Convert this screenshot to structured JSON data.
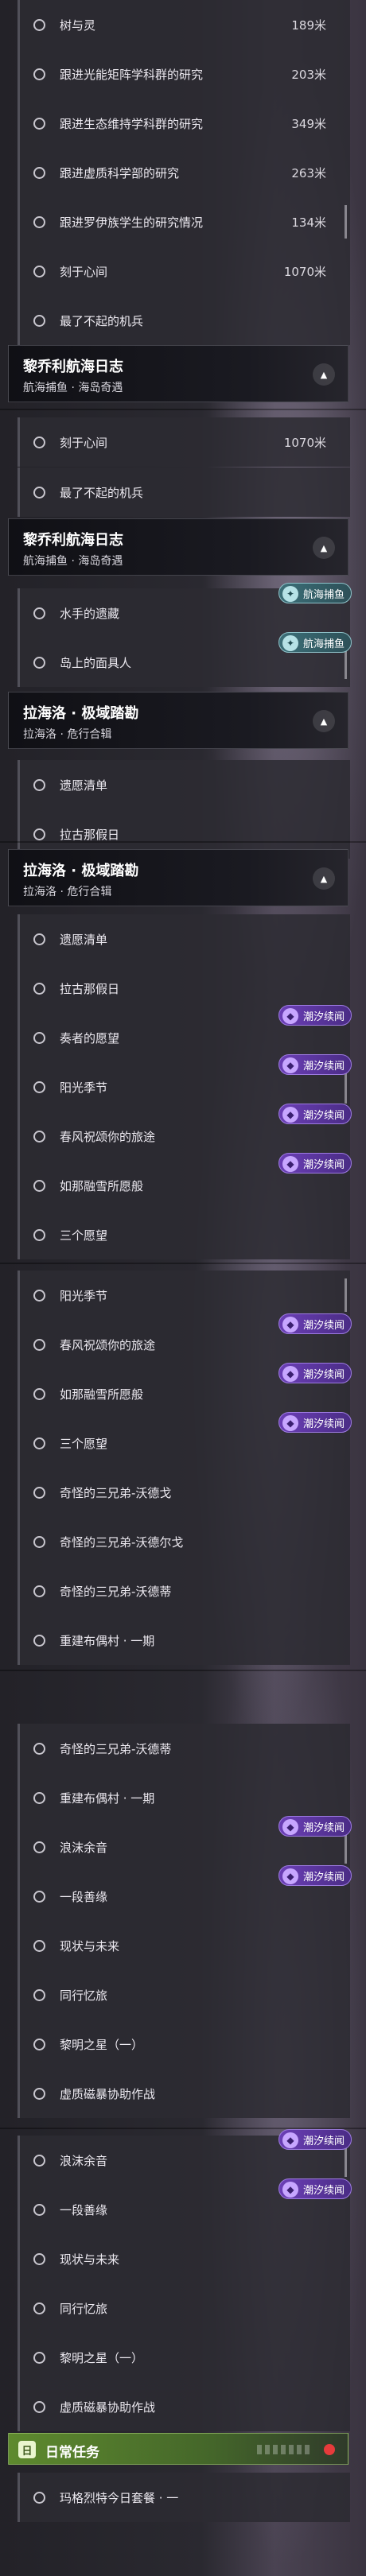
{
  "screens": [
    {
      "rows": [
        {
          "label": "树与灵",
          "dist": "189米"
        },
        {
          "label": "跟进光能矩阵学科群的研究",
          "dist": "203米"
        },
        {
          "label": "跟进生态维持学科群的研究",
          "dist": "349米"
        },
        {
          "label": "跟进虚质科学部的研究",
          "dist": "263米"
        },
        {
          "label": "跟进罗伊族学生的研究情况",
          "dist": "134米"
        },
        {
          "label": "刻于心间",
          "dist": "1070米"
        },
        {
          "label": "最了不起的机兵",
          "dist": ""
        }
      ],
      "header": {
        "title": "黎乔利航海日志",
        "sub": "航海捕鱼 · 海岛奇遇"
      }
    },
    {
      "rows": [
        {
          "label": "刻于心间",
          "dist": "1070米"
        },
        {
          "label": "最了不起的机兵",
          "dist": ""
        }
      ],
      "header": {
        "title": "黎乔利航海日志",
        "sub": "航海捕鱼 · 海岛奇遇"
      },
      "rows2": [
        {
          "label": "水手的遗藏",
          "tag": "航海捕鱼"
        },
        {
          "label": "岛上的面具人",
          "tag": "航海捕鱼"
        }
      ],
      "header2": {
        "title": "拉海洛 · 极域踏勘",
        "sub": "拉海洛 · 危行合辑"
      },
      "rows3": [
        {
          "label": "遗愿清单"
        },
        {
          "label": "拉古那假日"
        }
      ]
    },
    {
      "header": {
        "title": "拉海洛 · 极域踏勘",
        "sub": "拉海洛 · 危行合辑"
      },
      "rows": [
        {
          "label": "遗愿清单",
          "tag": ""
        },
        {
          "label": "拉古那假日",
          "tag": ""
        },
        {
          "label": "奏者的愿望",
          "tag": "潮汐续闻"
        },
        {
          "label": "阳光季节",
          "tag": "潮汐续闻"
        },
        {
          "label": "春风祝颂你的旅途",
          "tag": "潮汐续闻"
        },
        {
          "label": "如那融雪所愿般",
          "tag": "潮汐续闻"
        },
        {
          "label": "三个愿望",
          "tag": ""
        }
      ]
    },
    {
      "rows": [
        {
          "label": "阳光季节",
          "tag": ""
        },
        {
          "label": "春风祝颂你的旅途",
          "tag": "潮汐续闻"
        },
        {
          "label": "如那融雪所愿般",
          "tag": "潮汐续闻"
        },
        {
          "label": "三个愿望",
          "tag": "潮汐续闻"
        },
        {
          "label": "奇怪的三兄弟-沃德戈",
          "tag": ""
        },
        {
          "label": "奇怪的三兄弟-沃德尔戈",
          "tag": ""
        },
        {
          "label": "奇怪的三兄弟-沃德蒂",
          "tag": ""
        },
        {
          "label": "重建布偶村 · 一期",
          "tag": ""
        }
      ]
    },
    {
      "rows": [
        {
          "label": "奇怪的三兄弟-沃德蒂",
          "tag": ""
        },
        {
          "label": "重建布偶村 · 一期",
          "tag": ""
        },
        {
          "label": "浪沫余音",
          "tag": "潮汐续闻"
        },
        {
          "label": "一段善缘",
          "tag": "潮汐续闻"
        },
        {
          "label": "现状与未来",
          "tag": ""
        },
        {
          "label": "同行忆旅",
          "tag": ""
        },
        {
          "label": "黎明之星（一）",
          "tag": ""
        },
        {
          "label": "虚质磁暴协助作战",
          "tag": ""
        }
      ]
    },
    {
      "rows": [
        {
          "label": "浪沫余音",
          "tag": "潮汐续闻"
        },
        {
          "label": "一段善缘",
          "tag": "潮汐续闻"
        },
        {
          "label": "现状与未来",
          "tag": ""
        },
        {
          "label": "同行忆旅",
          "tag": ""
        },
        {
          "label": "黎明之星（一）",
          "tag": ""
        },
        {
          "label": "虚质磁暴协助作战",
          "tag": ""
        }
      ],
      "daily": {
        "title": "日常任务",
        "icon": "日"
      },
      "rows_after": [
        {
          "label": "玛格烈特今日套餐 · 一",
          "tag": ""
        }
      ]
    }
  ],
  "icons": {
    "collapse": "chevron-up-icon",
    "tag_purple": "wave-icon",
    "tag_teal": "fish-icon"
  },
  "colors": {
    "tag_purple": "#6b3fb6",
    "tag_teal": "#3c6f78",
    "daily": "#5e8a2e"
  }
}
